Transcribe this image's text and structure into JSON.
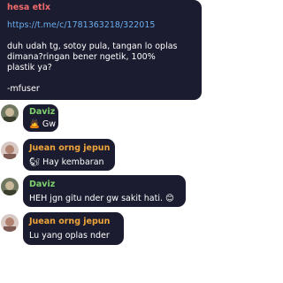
{
  "messages": [
    {
      "sender": "hesa etlx",
      "sender_color": "#ef6b6b",
      "link": "https://t.me/c/1781363218/322015",
      "lines": [
        "duh udah tg, sotoy pula, tangan lo oplas",
        "dimana?ringan bener ngetik, 100%",
        "plastik ya?"
      ],
      "signature": "-mfuser"
    },
    {
      "sender": "Daviz",
      "sender_color": "#7fd36e",
      "text": "Gw",
      "emoji_icon": "bowing-person-icon",
      "emoji": "🙇"
    },
    {
      "sender": "Juean orng jepun",
      "sender_color": "#f0a53a",
      "text": "Hay kembaran",
      "emoji_icon": "chipmunk-icon",
      "emoji": "🐿"
    },
    {
      "sender": "Daviz",
      "sender_color": "#7fd36e",
      "text": "HEH jgn gitu nder gw sakit hati.",
      "trailing_emoji_icon": "smiling-face-icon",
      "trailing_emoji": "😊"
    },
    {
      "sender": "Juean orng jepun",
      "sender_color": "#f0a53a",
      "text": "Lu yang oplas nder"
    }
  ],
  "colors": {
    "bubble": "#1b1c2f",
    "link": "#6aaeee",
    "text": "#ffffff",
    "background": "#ffffff"
  }
}
